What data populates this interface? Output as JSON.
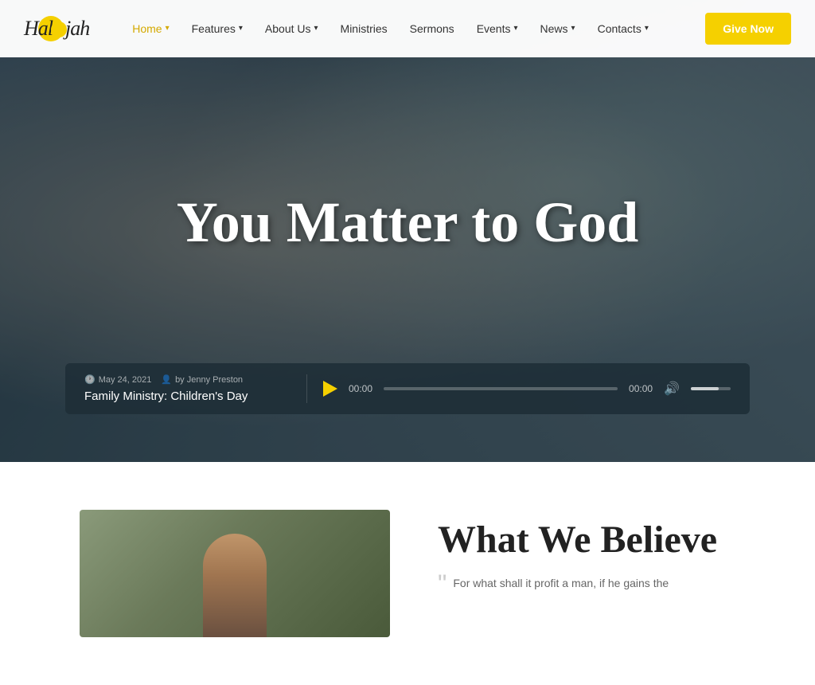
{
  "logo": {
    "text": "Hallelujah"
  },
  "nav": {
    "items": [
      {
        "label": "Home",
        "active": true,
        "hasDropdown": true
      },
      {
        "label": "Features",
        "active": false,
        "hasDropdown": true
      },
      {
        "label": "About Us",
        "active": false,
        "hasDropdown": true
      },
      {
        "label": "Ministries",
        "active": false,
        "hasDropdown": false
      },
      {
        "label": "Sermons",
        "active": false,
        "hasDropdown": false
      },
      {
        "label": "Events",
        "active": false,
        "hasDropdown": true
      },
      {
        "label": "News",
        "active": false,
        "hasDropdown": true
      },
      {
        "label": "Contacts",
        "active": false,
        "hasDropdown": true
      }
    ],
    "give_button": "Give Now"
  },
  "hero": {
    "title": "You Matter to God"
  },
  "audio_player": {
    "date": "May 24, 2021",
    "author": "by Jenny Preston",
    "title": "Family Ministry: Children's Day",
    "time_current": "00:00",
    "time_total": "00:00",
    "progress_percent": 0,
    "volume_percent": 70
  },
  "believe_section": {
    "title": "What We Believe",
    "quote": "For what shall it profit a man, if he gains the"
  }
}
